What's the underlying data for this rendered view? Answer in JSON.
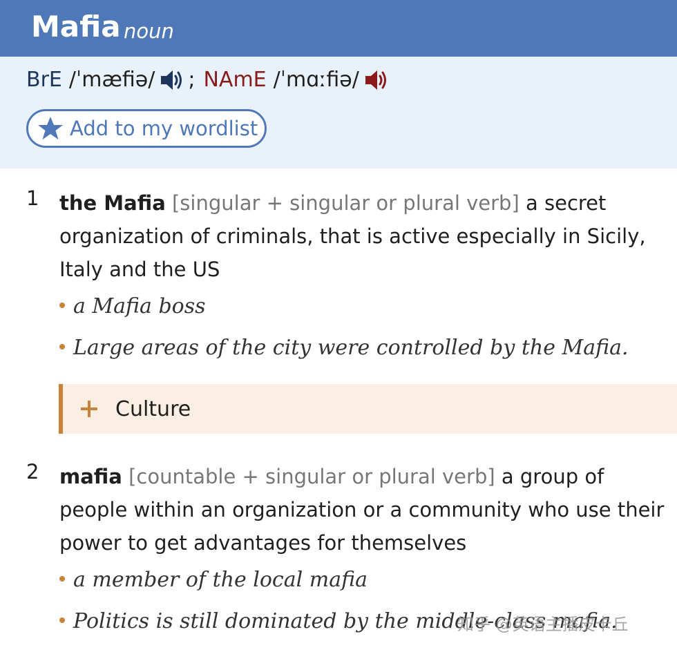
{
  "entry": {
    "headword": "Mafia",
    "part_of_speech": "noun"
  },
  "pronunciation": {
    "bre_label": "BrE",
    "bre_ipa": "/ˈmæfiə/",
    "separator": ";",
    "name_label": "NAmE",
    "name_ipa": "/ˈmɑːfiə/"
  },
  "wordlist_button": {
    "label": "Add to my wordlist"
  },
  "senses": [
    {
      "number": "1",
      "cf": "the Mafia",
      "grammar": "[singular + singular or plural verb]",
      "definition": "a secret organization of criminals, that is active especially in Sicily, Italy and the US",
      "examples": [
        "a Mafia boss",
        "Large areas of the city were controlled by the Mafia."
      ],
      "culture_label": "Culture"
    },
    {
      "number": "2",
      "cf": "mafia",
      "grammar": "[countable + singular or plural verb]",
      "definition": "a group of people within an organization or a community who use their power to get advantages for themselves",
      "examples": [
        "a member of the local mafia",
        "Politics is still dominated by the middle-class mafia."
      ]
    }
  ],
  "watermark": "知乎 @英语主播皮卡丘",
  "colors": {
    "header_bg": "#4f78b9",
    "pron_panel_bg": "#e9f1fa",
    "bre_speaker": "#1d355a",
    "name_speaker": "#8b1a1a",
    "accent_orange": "#c8823a",
    "culture_bg": "#fbeee3"
  },
  "icons": {
    "bre_audio": "speaker-icon",
    "name_audio": "speaker-icon",
    "wordlist": "star-icon",
    "culture_expand": "plus-icon",
    "example_bullet": "bullet-dot"
  }
}
